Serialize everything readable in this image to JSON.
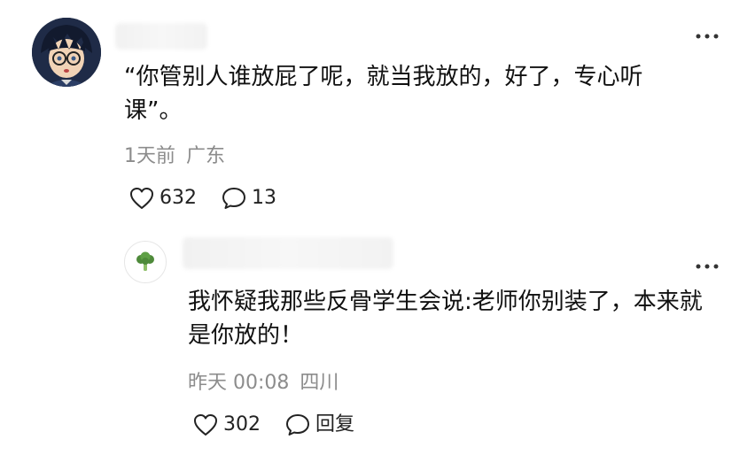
{
  "comment": {
    "text": "“你管别人谁放屁了呢，就当我放的，好了，专心听课”。",
    "time": "1天前",
    "location": "广东",
    "likes": "632",
    "replies": "13"
  },
  "reply": {
    "text": "我怀疑我那些反骨学生会说:老师你别装了，本来就是你放的！",
    "time": "昨天 00:08",
    "location": "四川",
    "likes": "302",
    "reply_label": "回复"
  },
  "icons": {
    "like": "heart-outline-icon",
    "comment": "speech-bubble-icon",
    "more": "more-dots-icon",
    "reply_avatar": "broccoli-icon"
  },
  "colors": {
    "meta_text": "#8c8c8c",
    "body_text": "#111111"
  }
}
